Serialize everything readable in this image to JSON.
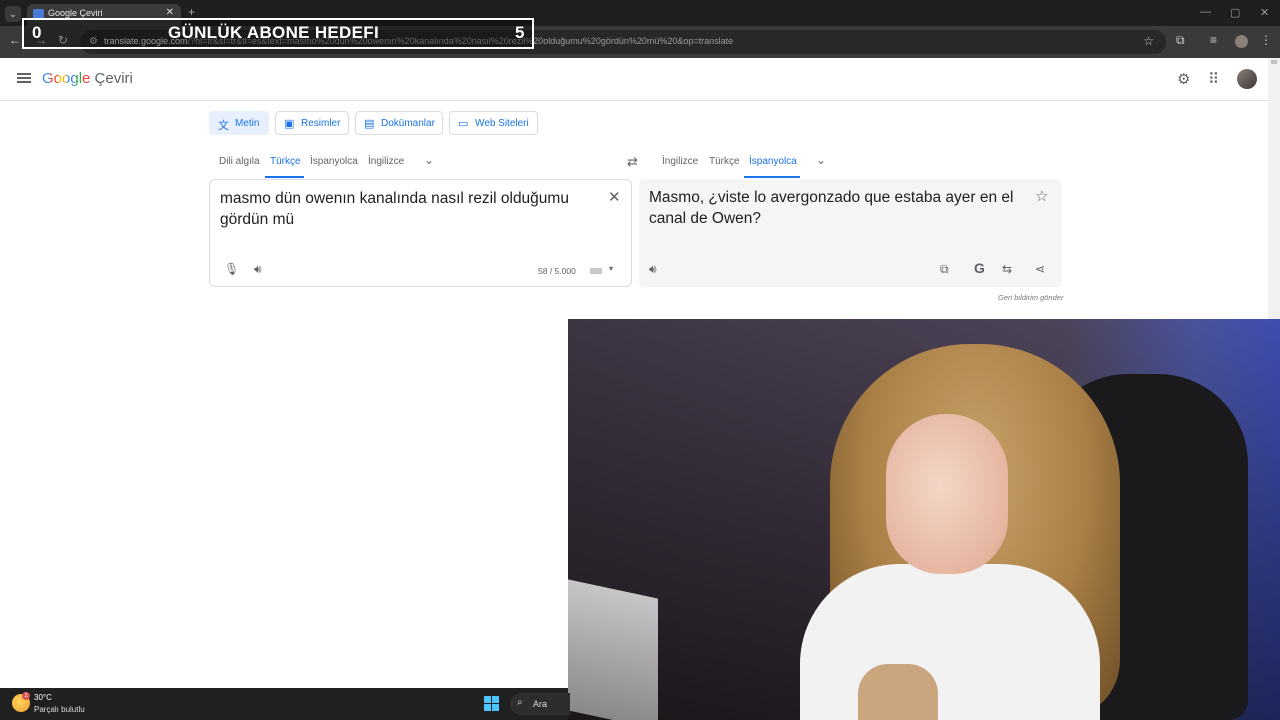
{
  "browser": {
    "tab_title": "Google Çeviri",
    "new_tab": "+",
    "url_host": "translate.google.com",
    "url_rest": "/?hl=tr&sl=tr&tl=es&text=masmo%20dün%20owenın%20kanalında%20nasıl%20rezil%20olduğumu%20gördün%20mü%20&op=translate"
  },
  "overlay": {
    "left_count": "0",
    "title": "GÜNLÜK ABONE HEDEFI",
    "right_count": "5"
  },
  "header": {
    "logo_google": "Google",
    "logo_product": "Çeviri"
  },
  "modes": [
    {
      "label": "Metin",
      "icon": "translate-icon"
    },
    {
      "label": "Resimler",
      "icon": "image-icon"
    },
    {
      "label": "Dokümanlar",
      "icon": "document-icon"
    },
    {
      "label": "Web Siteleri",
      "icon": "website-icon"
    }
  ],
  "source_langs": [
    "Dili algıla",
    "Türkçe",
    "İspanyolca",
    "İngilizce"
  ],
  "target_langs": [
    "İngilizce",
    "Türkçe",
    "İspanyolca"
  ],
  "source": {
    "text": "masmo dün owenın kanalında nasıl rezil olduğumu gördün mü",
    "char_count": "58 / 5.000"
  },
  "target": {
    "text": "Masmo, ¿viste lo avergonzado que estaba ayer en el canal de Owen?"
  },
  "feedback": "Geri bildirim gönder",
  "taskbar": {
    "temperature": "30°C",
    "weather": "Parçalı bulutlu",
    "weather_badge": "1",
    "search_label": "Ara"
  },
  "colors": {
    "accent": "#1a73e8",
    "active_mode_bg": "#e8f0fe"
  }
}
